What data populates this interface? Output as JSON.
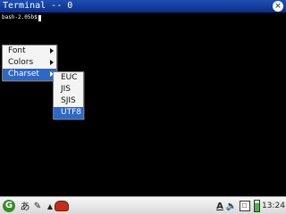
{
  "window": {
    "title": "Terminal -- 0",
    "close_glyph": "×"
  },
  "terminal": {
    "prompt": "bash-2.05b$"
  },
  "context_menu": {
    "items": [
      {
        "label": "Font",
        "has_submenu": true
      },
      {
        "label": "Colors",
        "has_submenu": true
      },
      {
        "label": "Charset",
        "has_submenu": true,
        "active": true
      }
    ]
  },
  "charset_submenu": {
    "items": [
      {
        "label": "EUC"
      },
      {
        "label": "JIS"
      },
      {
        "label": "SJIS"
      },
      {
        "label": "UTF8",
        "selected": true
      }
    ]
  },
  "taskbar": {
    "start_icon": "G",
    "ime_label": "あ",
    "pen_icon": "✎",
    "up_arrow": "▲",
    "font_indicator": "A",
    "volume_icon": "🔈",
    "keyboard_glyph": "☐",
    "clock": "13:24"
  },
  "colors": {
    "titlebar": "#1d4fb3",
    "menu_highlight": "#2c68c9",
    "terminal_bg": "#000000"
  }
}
